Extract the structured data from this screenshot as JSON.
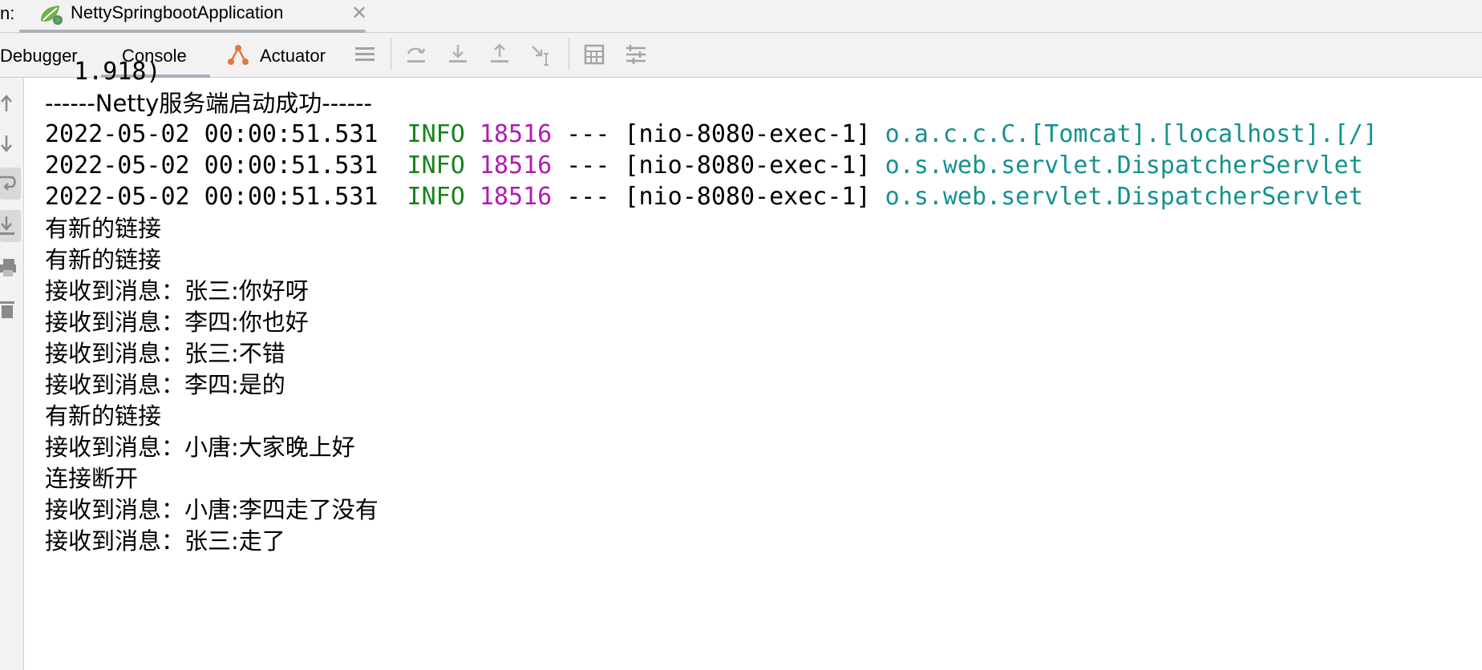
{
  "run_tabs": {
    "prefix": "n:",
    "app_title": "NettySpringbootApplication"
  },
  "tool_tabs": [
    {
      "label": "Debugger"
    },
    {
      "label": "Console"
    },
    {
      "label": "Actuator"
    }
  ],
  "console": {
    "truncated_first": "  1.918)",
    "startup_line": "------Netty服务端启动成功------",
    "log_lines": [
      {
        "timestamp": "2022-05-02 00:00:51.531",
        "level": "INFO",
        "pid": "18516",
        "sep": "---",
        "thread": "[nio-8080-exec-1]",
        "logger": "o.a.c.c.C.[Tomcat].[localhost].[/]"
      },
      {
        "timestamp": "2022-05-02 00:00:51.531",
        "level": "INFO",
        "pid": "18516",
        "sep": "---",
        "thread": "[nio-8080-exec-1]",
        "logger": "o.s.web.servlet.DispatcherServlet"
      },
      {
        "timestamp": "2022-05-02 00:00:51.531",
        "level": "INFO",
        "pid": "18516",
        "sep": "---",
        "thread": "[nio-8080-exec-1]",
        "logger": "o.s.web.servlet.DispatcherServlet"
      }
    ],
    "messages": [
      "有新的链接",
      "有新的链接",
      "接收到消息：张三:你好呀",
      "接收到消息：李四:你也好",
      "接收到消息：张三:不错",
      "接收到消息：李四:是的",
      "有新的链接",
      "接收到消息：小唐:大家晚上好",
      "连接断开",
      "接收到消息：小唐:李四走了没有",
      "接收到消息：张三:走了"
    ]
  },
  "colors": {
    "info": "#16841a",
    "pid": "#b21ab2",
    "logger": "#14918f",
    "accent_tab_underline": "#a7b0bb"
  },
  "icons": [
    "spring-boot-app-icon",
    "close-icon",
    "actuator-icon",
    "threads-menu-icon",
    "step-over-icon",
    "step-into-icon",
    "step-out-icon",
    "run-to-cursor-icon",
    "evaluate-expression-icon",
    "trace-icon",
    "scroll-up-icon",
    "scroll-down-icon",
    "soft-wrap-icon",
    "scroll-to-end-icon",
    "print-icon",
    "clear-all-icon"
  ]
}
